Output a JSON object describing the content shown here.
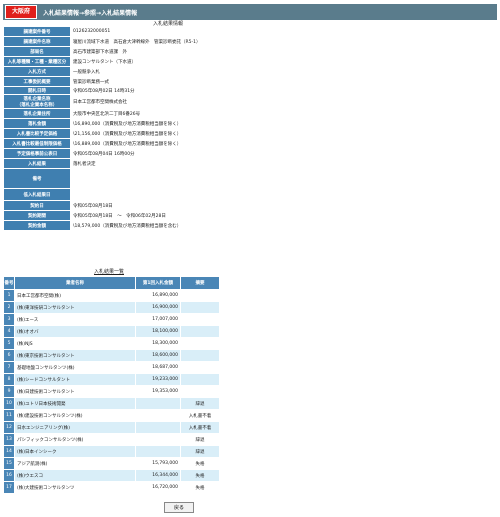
{
  "header": {
    "logo": "大阪府",
    "breadcrumb": "入札結果情報→参照→入札結果情報"
  },
  "info_title": "入札結果情報",
  "info_rows": [
    {
      "label": "調達案件番号",
      "value": "0126232000051"
    },
    {
      "label": "調達案件名称",
      "value": "寝屋川流域下水道　高石倉大津幹線外　管渠診断委託（R5-1）"
    },
    {
      "label": "部局名",
      "value": "高石市建築部下水道課　外"
    },
    {
      "label": "入札等種類・工種・業種区分",
      "value": "建設コンサルタント（下水道）"
    },
    {
      "label": "入札方式",
      "value": "一般競争入札"
    },
    {
      "label": "工事委託概要",
      "value": "管渠診断業務一式"
    },
    {
      "label": "開札日時",
      "value": "令和05年08月02日 14時31分"
    },
    {
      "label": "落札企業名称\n（落札企業本名称）",
      "value": "日本工営都市空間株式会社"
    },
    {
      "label": "落札企業住所",
      "value": "大阪市中央区北浜二丁目6番26号"
    },
    {
      "label": "落札金額",
      "value": "\\16,890,000（消費税及び地方消費税相当額を除く）"
    },
    {
      "label": "入札書比較予定価格",
      "value": "\\21,156,000（消費税及び地方消費税相当額を除く）"
    },
    {
      "label": "入札書比較最低制限価格",
      "value": "\\16,889,000（消費税及び地方消費税相当額を除く）"
    },
    {
      "label": "予定価格事前公表日",
      "value": "令和05年08月04日 16時00分"
    },
    {
      "label": "入札結果",
      "value": "落札者決定"
    },
    {
      "label": "備考",
      "value": ""
    },
    {
      "label": "低入札結果日",
      "value": ""
    },
    {
      "label": "契約日",
      "value": "令和05年08月18日"
    },
    {
      "label": "契約期間",
      "value": "令和05年08月18日　～　令和06年02月28日"
    },
    {
      "label": "契約金額",
      "value": "\\18,579,000（消費税及び地方消費税相当額を含む）"
    }
  ],
  "results_title": "入札結果一覧",
  "results_headers": [
    "番号",
    "業者名称",
    "第1回入札金額",
    "摘要"
  ],
  "results": [
    {
      "no": "1",
      "name": "日本工営都市空間(株)",
      "amount": "16,890,000",
      "remark": ""
    },
    {
      "no": "2",
      "name": "(株)東洋技研コンサルタント",
      "amount": "16,900,000",
      "remark": ""
    },
    {
      "no": "3",
      "name": "(株)エース",
      "amount": "17,007,000",
      "remark": ""
    },
    {
      "no": "4",
      "name": "(株)オオバ",
      "amount": "18,100,000",
      "remark": ""
    },
    {
      "no": "5",
      "name": "(株)NJS",
      "amount": "18,300,000",
      "remark": ""
    },
    {
      "no": "6",
      "name": "(株)東京技術コンサルタント",
      "amount": "18,600,000",
      "remark": ""
    },
    {
      "no": "7",
      "name": "基礎地盤コンサルタンツ(株)",
      "amount": "18,687,000",
      "remark": ""
    },
    {
      "no": "8",
      "name": "(株)シードコンサルタント",
      "amount": "19,233,000",
      "remark": ""
    },
    {
      "no": "9",
      "name": "(株)日建技術コンサルタント",
      "amount": "19,353,000",
      "remark": ""
    },
    {
      "no": "10",
      "name": "(株)ユトリ日本技術開発",
      "amount": "",
      "remark": "辞退"
    },
    {
      "no": "11",
      "name": "(株)建設技術コンサルタンツ(株)",
      "amount": "",
      "remark": "入札書不着"
    },
    {
      "no": "12",
      "name": "日水エンジニアリング(株)",
      "amount": "",
      "remark": "入札書不着"
    },
    {
      "no": "13",
      "name": "パシフィックコンサルタンツ(株)",
      "amount": "",
      "remark": "辞退"
    },
    {
      "no": "14",
      "name": "(株)日本インシーク",
      "amount": "",
      "remark": "辞退"
    },
    {
      "no": "15",
      "name": "アジア航測(株)",
      "amount": "15,793,000",
      "remark": "失格"
    },
    {
      "no": "16",
      "name": "(株)ウエスコ",
      "amount": "16,344,000",
      "remark": "失格"
    },
    {
      "no": "17",
      "name": "(株)大建技術コンサルタンツ",
      "amount": "16,720,000",
      "remark": "失格"
    }
  ],
  "back_label": "戻る"
}
